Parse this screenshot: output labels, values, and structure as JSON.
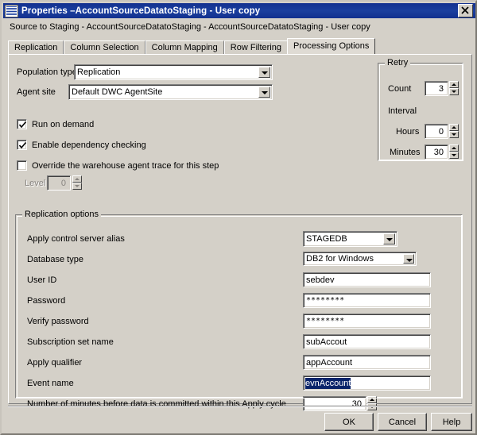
{
  "window": {
    "title": "Properties –AccountSourceDatatoStaging - User copy",
    "icon": "properties-grid-icon",
    "close_label": "close-icon",
    "subtitle": "Source to Staging - AccountSourceDatatoStaging - AccountSourceDatatoStaging - User copy",
    "bg_color": "#d4d0c8",
    "titlebar_color": "#12308f",
    "selection_color": "#0a246a"
  },
  "tabs": [
    {
      "label": "Replication",
      "active": false
    },
    {
      "label": "Column Selection",
      "active": false
    },
    {
      "label": "Column Mapping",
      "active": false
    },
    {
      "label": "Row Filtering",
      "active": false
    },
    {
      "label": "Processing Options",
      "active": true
    }
  ],
  "top_section": {
    "population_type": {
      "label": "Population type",
      "value": "Replication"
    },
    "agent_site": {
      "label": "Agent site",
      "value": "Default DWC AgentSite"
    },
    "checkboxes": [
      {
        "label": "Run on demand",
        "checked": true
      },
      {
        "label": "Enable dependency checking",
        "checked": true
      },
      {
        "label": "Override the warehouse agent trace for this step",
        "checked": false
      }
    ],
    "level": {
      "label": "Level",
      "value": "0",
      "disabled": true
    }
  },
  "retry": {
    "title": "Retry",
    "count": {
      "label": "Count",
      "value": "3"
    },
    "interval_label": "Interval",
    "hours": {
      "label": "Hours",
      "value": "0"
    },
    "minutes": {
      "label": "Minutes",
      "value": "30"
    }
  },
  "replication_options": {
    "title": "Replication options",
    "rows": [
      {
        "label": "Apply control server alias",
        "value": "STAGEDB",
        "type": "combo"
      },
      {
        "label": "Database type",
        "value": "DB2 for Windows",
        "type": "combo"
      },
      {
        "label": "User ID",
        "value": "sebdev",
        "type": "text"
      },
      {
        "label": "Password",
        "value": "********",
        "type": "password"
      },
      {
        "label": "Verify password",
        "value": "********",
        "type": "password"
      },
      {
        "label": "Subscription set name",
        "value": "subAccout",
        "type": "text"
      },
      {
        "label": "Apply qualifier",
        "value": "appAccount",
        "type": "text"
      },
      {
        "label": "Event name",
        "value": "evnAccount",
        "type": "text-selected"
      },
      {
        "label": "Number of minutes before data is committed within this Apply cycle",
        "value": "30",
        "type": "spinner"
      }
    ]
  },
  "buttons": {
    "ok": "OK",
    "cancel": "Cancel",
    "help": "Help"
  }
}
